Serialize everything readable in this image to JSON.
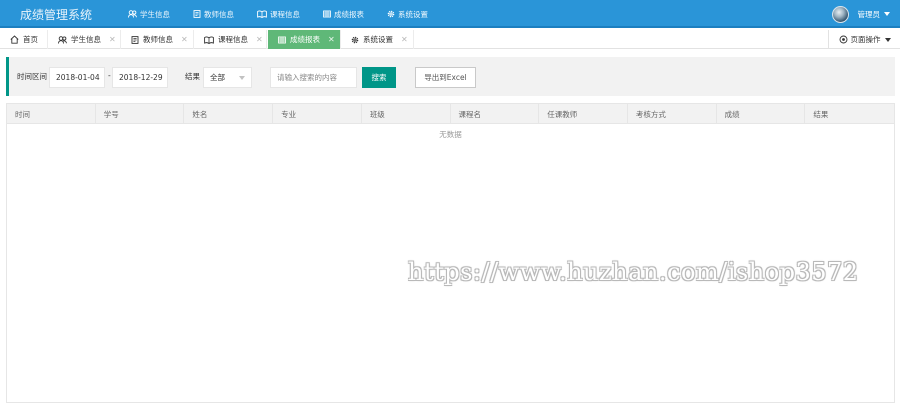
{
  "header": {
    "app_title": "成绩管理系统",
    "nav": [
      {
        "label": "学生信息",
        "icon": "users-icon"
      },
      {
        "label": "教师信息",
        "icon": "document-icon"
      },
      {
        "label": "课程信息",
        "icon": "book-icon"
      },
      {
        "label": "成绩报表",
        "icon": "table-icon"
      },
      {
        "label": "系统设置",
        "icon": "gear-icon"
      }
    ],
    "user_label": "管理员"
  },
  "tabs": {
    "items": [
      {
        "label": "首页",
        "icon": "home-icon",
        "closable": false,
        "active": false
      },
      {
        "label": "学生信息",
        "icon": "users-icon",
        "closable": true,
        "active": false
      },
      {
        "label": "教师信息",
        "icon": "document-icon",
        "closable": true,
        "active": false
      },
      {
        "label": "课程信息",
        "icon": "book-icon",
        "closable": true,
        "active": false
      },
      {
        "label": "成绩报表",
        "icon": "table-icon",
        "closable": true,
        "active": true
      },
      {
        "label": "系统设置",
        "icon": "gear-icon",
        "closable": true,
        "active": false
      }
    ],
    "close_glyph": "✕",
    "page_ops_label": "页面操作"
  },
  "search": {
    "date_range_label": "时间区间",
    "start_date": "2018-01-04",
    "separator": "-",
    "end_date": "2018-12-29",
    "result_label": "结果",
    "result_selected": "全部",
    "keyword_placeholder": "请输入搜索的内容",
    "search_button": "搜索",
    "export_button": "导出到Excel"
  },
  "table": {
    "columns": [
      "时间",
      "学号",
      "姓名",
      "专业",
      "班级",
      "课程名",
      "任课教师",
      "考核方式",
      "成绩",
      "结果"
    ],
    "rows": [],
    "empty_text": "无数据"
  },
  "watermark": "https://www.huzhan.com/ishop3572",
  "colors": {
    "header_bg": "#2a95d8",
    "active_tab": "#5fb878",
    "primary_button": "#009688"
  }
}
